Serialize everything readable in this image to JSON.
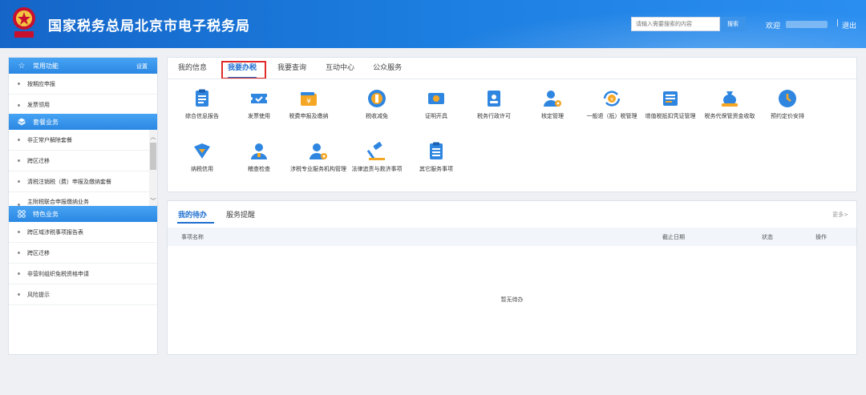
{
  "header": {
    "title": "国家税务总局北京市电子税务局",
    "search_placeholder": "请输入需要搜索的内容",
    "search_button": "搜索",
    "welcome": "欢迎",
    "separator": "|",
    "logout": "退出"
  },
  "sidebar": {
    "sections": [
      {
        "title": "常用功能",
        "icon": "star-icon",
        "action": "设置",
        "items": [
          "按期应申报",
          "发票领用"
        ]
      },
      {
        "title": "套餐业务",
        "icon": "cube-icon",
        "items": [
          "非正常户解除套餐",
          "跨区迁移",
          "清税注销税（费）申报及缴纳套餐",
          "主附税联合申报缴纳业务"
        ]
      },
      {
        "title": "特色业务",
        "icon": "grid-icon",
        "items": [
          "跨区域涉税事项报告表",
          "跨区迁移",
          "非营利组织免税资格申请",
          "风险提示"
        ]
      }
    ]
  },
  "main": {
    "tabs": [
      "我的信息",
      "我要办税",
      "我要查询",
      "互动中心",
      "公众服务"
    ],
    "active_tab": "我要办税",
    "services_row1": [
      {
        "label": "综合信息报告",
        "icon": "document-icon"
      },
      {
        "label": "发票使用",
        "icon": "ticket-icon"
      },
      {
        "label": "税费申报及缴纳",
        "icon": "wallet-icon"
      },
      {
        "label": "税收减免",
        "icon": "coin-icon"
      },
      {
        "label": "证明开具",
        "icon": "certificate-icon"
      },
      {
        "label": "税务行政许可",
        "icon": "id-card-icon"
      },
      {
        "label": "核定管理",
        "icon": "person-gear-icon"
      },
      {
        "label": "一般退（抵）税管理",
        "icon": "refund-icon"
      },
      {
        "label": "增值税抵扣凭证管理",
        "icon": "invoice-icon"
      },
      {
        "label": "税务代保管资金收取",
        "icon": "money-bag-icon"
      },
      {
        "label": "预约定价安排",
        "icon": "clock-icon"
      }
    ],
    "services_row2": [
      {
        "label": "纳税信用",
        "icon": "shield-heart-icon"
      },
      {
        "label": "稽查检查",
        "icon": "person-icon"
      },
      {
        "label": "涉税专业服务机构管理",
        "icon": "person-gear-icon"
      },
      {
        "label": "法律追责与救济事项",
        "icon": "gavel-icon"
      },
      {
        "label": "其它服务事项",
        "icon": "list-icon"
      }
    ]
  },
  "todo": {
    "tabs": [
      "我的待办",
      "服务提醒"
    ],
    "more": "更多>",
    "columns": [
      "事项名称",
      "截止日期",
      "状态",
      "操作"
    ],
    "empty": "暂无待办"
  },
  "colors": {
    "header_blue": "#1c7ee0",
    "accent_blue": "#1f6fd0",
    "icon_blue": "#2f86e0",
    "icon_orange": "#f5a623",
    "highlight_red": "#e02a2a"
  }
}
